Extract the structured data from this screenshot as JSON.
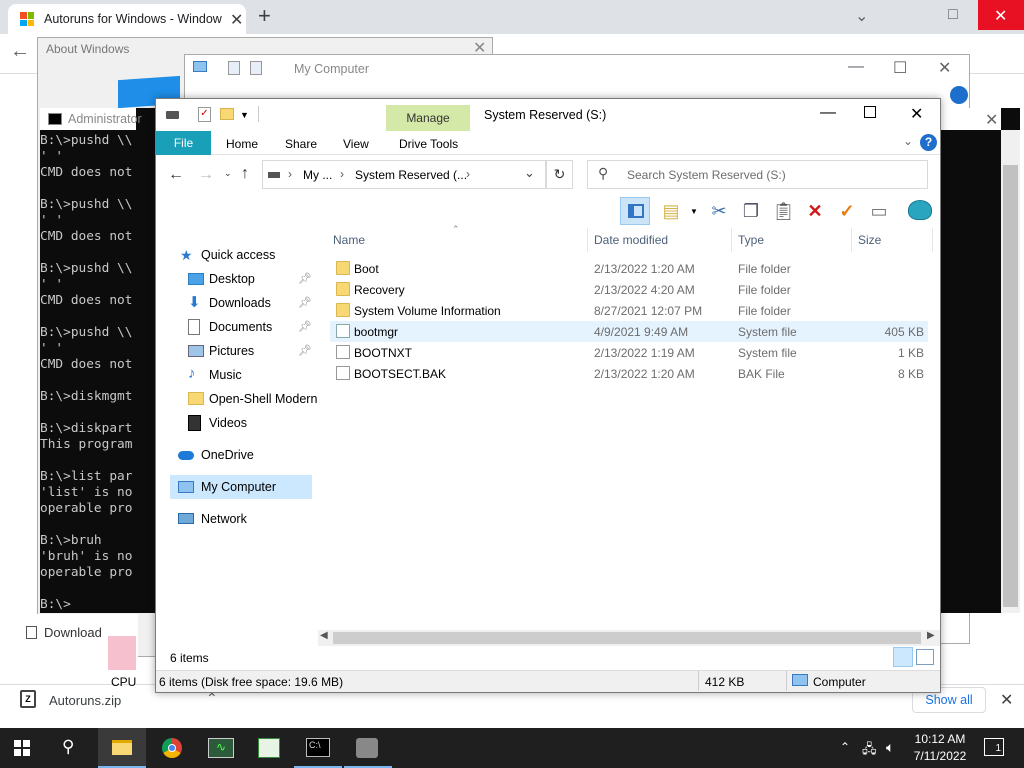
{
  "chrome": {
    "tab_title": "Autoruns for Windows - Windows Sysinternals",
    "tab_close": "✕",
    "new_tab": "+",
    "back": "←",
    "win_min": "⌄",
    "win_max": "□",
    "win_close": "✕"
  },
  "downloads": {
    "file_name": "Autoruns.zip",
    "show_all": "Show all",
    "close": "✕",
    "download_label": "Download"
  },
  "about_window": {
    "title": "About Windows",
    "close": "✕"
  },
  "my_computer_window": {
    "title": "My Computer",
    "min": "—",
    "max": "☐",
    "close": "✕"
  },
  "cmd": {
    "title": "Administrator",
    "lines": "B:\\>pushd \\\\\n' '\nCMD does not\n\nB:\\>pushd \\\\\n' '\nCMD does not\n\nB:\\>pushd \\\\\n' '\nCMD does not\n\nB:\\>pushd \\\\\n' '\nCMD does not\n\nB:\\>diskmgmt\n\nB:\\>diskpart\nThis program\n\nB:\\>list par\n'list' is no\noperable pro\n\nB:\\>bruh\n'bruh' is no\noperable pro\n\nB:\\>",
    "close": "✕"
  },
  "explorer": {
    "title": "System Reserved (S:)",
    "manage_tab": "Manage",
    "tabs": {
      "file": "File",
      "home": "Home",
      "share": "Share",
      "view": "View",
      "drive_tools": "Drive Tools"
    },
    "help": "?",
    "address": {
      "seg1": "My ...",
      "seg2": "System Reserved (...",
      "sep": "›"
    },
    "search_placeholder": "Search System Reserved (S:)",
    "columns": {
      "name": "Name",
      "date": "Date modified",
      "type": "Type",
      "size": "Size"
    },
    "files": [
      {
        "name": "Boot",
        "date": "2/13/2022 1:20 AM",
        "type": "File folder",
        "size": ""
      },
      {
        "name": "Recovery",
        "date": "2/13/2022 4:20 AM",
        "type": "File folder",
        "size": ""
      },
      {
        "name": "System Volume Information",
        "date": "8/27/2021 12:07 PM",
        "type": "File folder",
        "size": ""
      },
      {
        "name": "bootmgr",
        "date": "4/9/2021 9:49 AM",
        "type": "System file",
        "size": "405 KB"
      },
      {
        "name": "BOOTNXT",
        "date": "2/13/2022 1:19 AM",
        "type": "System file",
        "size": "1 KB"
      },
      {
        "name": "BOOTSECT.BAK",
        "date": "2/13/2022 1:20 AM",
        "type": "BAK File",
        "size": "8 KB"
      }
    ],
    "nav": {
      "quick_access": "Quick access",
      "desktop": "Desktop",
      "downloads": "Downloads",
      "documents": "Documents",
      "pictures": "Pictures",
      "music": "Music",
      "open_shell": "Open-Shell Modern",
      "videos": "Videos",
      "onedrive": "OneDrive",
      "my_computer": "My Computer",
      "network": "Network"
    },
    "status_count": "6 items",
    "status_detail": "6 items (Disk free space: 19.6 MB)",
    "status_size": "412 KB",
    "status_location": "Computer"
  },
  "taskbar": {
    "time": "10:12 AM",
    "date": "7/11/2022",
    "notification_count": "1",
    "cpu_label": "CPU"
  }
}
